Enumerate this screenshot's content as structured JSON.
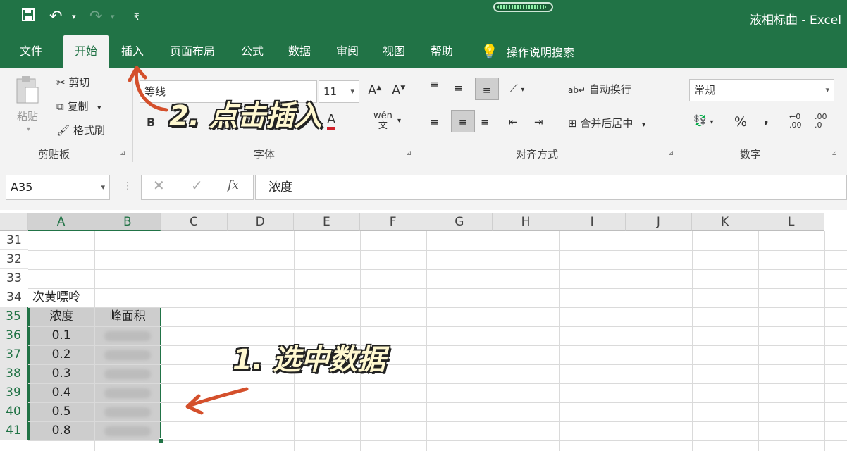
{
  "app": {
    "doc_title": "液相标曲 - Excel"
  },
  "tabs": [
    "文件",
    "开始",
    "插入",
    "页面布局",
    "公式",
    "数据",
    "审阅",
    "视图",
    "帮助"
  ],
  "tell_me": "操作说明搜索",
  "clipboard": {
    "paste": "粘贴",
    "cut": "剪切",
    "copy": "复制",
    "format_painter": "格式刷",
    "label": "剪贴板"
  },
  "font": {
    "name": "等线",
    "size": "11",
    "bold": "B",
    "label": "字体",
    "grow": "A",
    "shrink": "A"
  },
  "alignment": {
    "wrap": "自动换行",
    "merge": "合并后居中",
    "label": "对齐方式"
  },
  "number": {
    "format": "常规",
    "percent": "%",
    "comma": ",",
    "label": "数字",
    "inc": ".00",
    "dec": ".0"
  },
  "formula_bar": {
    "name_box": "A35",
    "content": "浓度",
    "fx": "fx"
  },
  "columns": [
    "A",
    "B",
    "C",
    "D",
    "E",
    "F",
    "G",
    "H",
    "I",
    "J",
    "K",
    "L"
  ],
  "rows": [
    "31",
    "32",
    "33",
    "34",
    "35",
    "36",
    "37",
    "38",
    "39",
    "40",
    "41"
  ],
  "sheet": {
    "title_cell": "次黄嘌呤",
    "header_a": "浓度",
    "header_b": "峰面积",
    "concentrations": [
      "0.1",
      "0.2",
      "0.3",
      "0.4",
      "0.5",
      "0.8"
    ]
  },
  "annotations": {
    "step1": "1. 选中数据",
    "step2": "2. 点击插入"
  },
  "colors": {
    "excel_green": "#217346",
    "arrow": "#d4502c"
  },
  "progress": 0.9
}
